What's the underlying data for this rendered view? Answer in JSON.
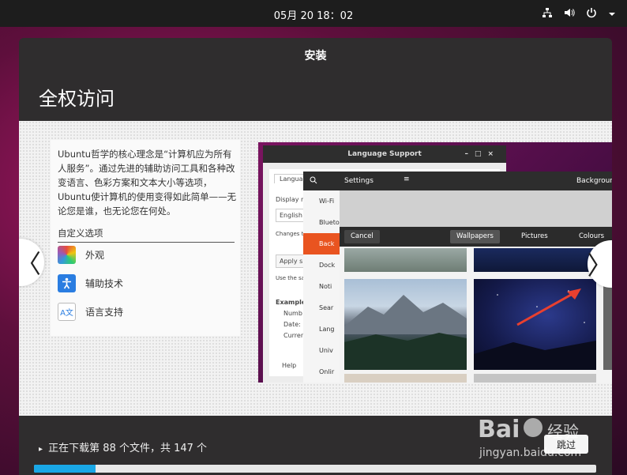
{
  "topbar": {
    "clock": "05月 20  18：02",
    "tray_icons": [
      "network-icon",
      "volume-icon",
      "power-icon",
      "chevron-down-icon"
    ]
  },
  "window": {
    "title": "安装",
    "heading": "全权访问"
  },
  "panel": {
    "description": "Ubuntu哲学的核心理念是“计算机应为所有人服务”。通过先进的辅助访问工具和各种改变语言、色彩方案和文本大小等选项，Ubuntu使计算机的使用变得如此简单——无论您是谁，也无论您在何处。",
    "custom_label": "自定义选项",
    "options": [
      {
        "label": "外观",
        "icon": "appearance-icon"
      },
      {
        "label": "辅助技术",
        "icon": "accessibility-icon"
      },
      {
        "label": "语言支持",
        "icon": "language-icon",
        "glyphs": "A文"
      }
    ]
  },
  "nav": {
    "prev": "〈",
    "next": "〉"
  },
  "preview": {
    "language_window": {
      "title": "Language Support",
      "tab": "Languag",
      "display_label": "Display m",
      "select_value": "English (",
      "changes_text": "Changes ta",
      "apply_button": "Apply s",
      "use_text": "Use the san",
      "example_label": "Example",
      "number_label": "Numb",
      "date_label": "Date:",
      "currency_label": "Curren",
      "help_label": "Help"
    },
    "settings_window": {
      "title": "Settings",
      "right_title": "Backgroun",
      "sidebar": [
        "Wi-Fi",
        "Bluetooth",
        "Back",
        "Dock",
        "Noti",
        "Sear",
        "Lang",
        "Univ",
        "Onlir"
      ]
    },
    "background_dialog": {
      "cancel": "Cancel",
      "tabs": [
        "Wallpapers",
        "Pictures",
        "Colours"
      ]
    }
  },
  "footer": {
    "status": "正在下载第 88 个文件，共 147 个",
    "progress": 0.11,
    "skip_button": "跳过"
  },
  "watermark": {
    "brand": "Baidu 经验",
    "url": "jingyan.baidu.com"
  }
}
